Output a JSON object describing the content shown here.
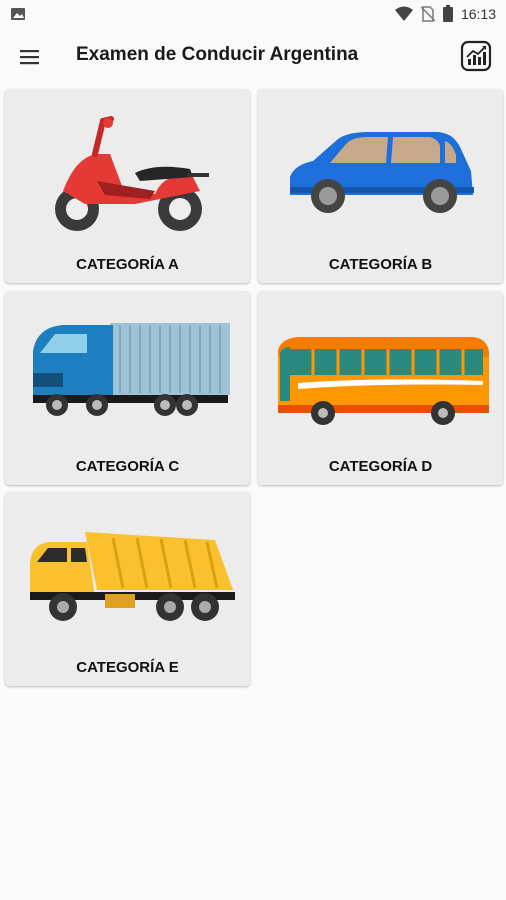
{
  "status_bar": {
    "time": "16:13",
    "icons": [
      "gallery-icon",
      "wifi-icon",
      "no-sim-icon",
      "battery-icon"
    ]
  },
  "app_bar": {
    "title": "Examen de Conducir Argentina",
    "menu_icon": "hamburger-menu-icon",
    "action_icon": "stats-chart-icon"
  },
  "categories": [
    {
      "label": "CATEGORÍA A",
      "icon": "motorcycle-icon"
    },
    {
      "label": "CATEGORÍA B",
      "icon": "car-icon"
    },
    {
      "label": "CATEGORÍA C",
      "icon": "truck-icon"
    },
    {
      "label": "CATEGORÍA D",
      "icon": "bus-icon"
    },
    {
      "label": "CATEGORÍA E",
      "icon": "dump-truck-icon"
    }
  ],
  "colors": {
    "background": "#fafafa",
    "card": "#ececec",
    "motorcycle": "#e53935",
    "car": "#1e6fd9",
    "truck_cab": "#1e7fc0",
    "bus": "#ff9800",
    "dump_truck": "#fbc02d"
  }
}
